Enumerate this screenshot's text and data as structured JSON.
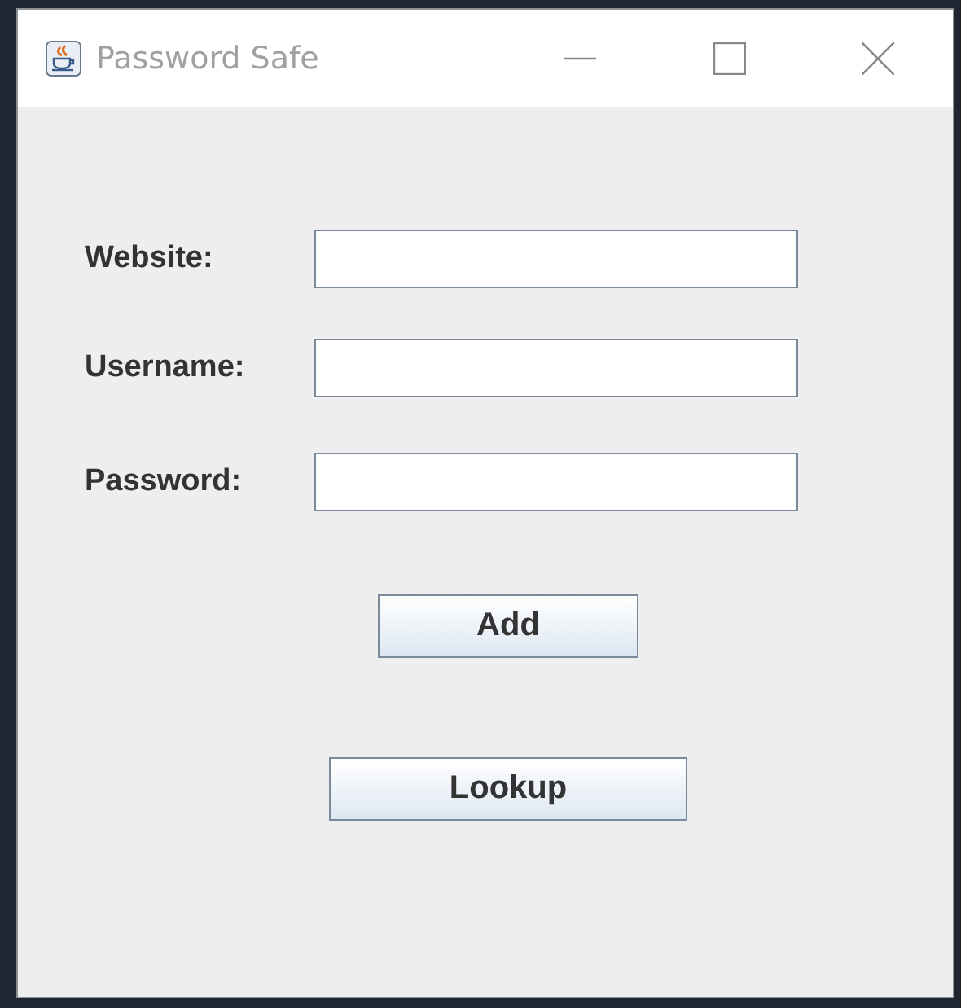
{
  "window": {
    "title": "Password Safe"
  },
  "fields": [
    {
      "label": "Website:"
    },
    {
      "label": "Username:"
    },
    {
      "label": "Password:"
    }
  ],
  "buttons": [
    {
      "label": "Add",
      "kind": "small"
    },
    {
      "label": "Lookup",
      "kind": "wide"
    }
  ]
}
